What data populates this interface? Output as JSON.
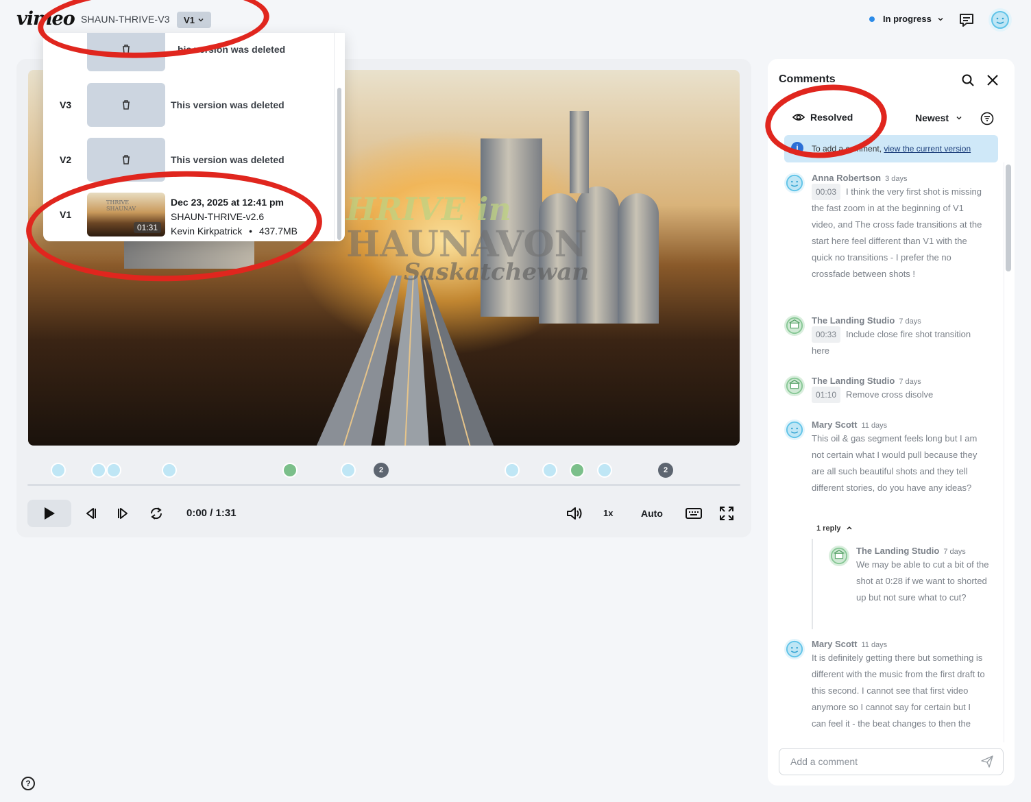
{
  "topbar": {
    "logo": "vimeo",
    "project_name": "SHAUN-THRIVE-V3",
    "version_label": "V1",
    "status_label": "In progress"
  },
  "video": {
    "overlay_line1": "HRIVE in",
    "overlay_line2": "HAUNAVON",
    "overlay_line3": "Saskatchewan"
  },
  "timeline_counts": [
    "2",
    "2"
  ],
  "controls": {
    "time": "0:00 / 1:31",
    "speed": "1x",
    "quality": "Auto"
  },
  "versions": {
    "deleted_text": "This version was deleted",
    "partial_deleted_text": "his version was deleted",
    "rows": [
      {
        "label": "V3"
      },
      {
        "label": "V2"
      }
    ],
    "current": {
      "label": "V1",
      "duration": "01:31",
      "date": "Dec 23, 2025 at 12:41 pm",
      "file": "SHAUN-THRIVE-v2.6",
      "author": "Kevin Kirkpatrick",
      "separator": "•",
      "size": "437.7MB",
      "thumb_text": "THRIVE SHAUNAV"
    }
  },
  "comments_panel": {
    "title": "Comments",
    "resolved_label": "Resolved",
    "sort_label": "Newest",
    "banner_prefix": "To add a comment, ",
    "banner_link": "view the current version",
    "items": [
      {
        "author": "Anna Robertson",
        "ago": "3 days",
        "timestamp": "00:03",
        "text": "I think the very first shot is missing the fast zoom in at the beginning of V1 video, and The cross fade transitions at the start here feel different than V1 with the quick no transitions - I prefer the no crossfade between shots !"
      },
      {
        "author": "The Landing Studio",
        "ago": "7 days",
        "timestamp": "00:33",
        "text": "Include close fire shot transition here"
      },
      {
        "author": "The Landing Studio",
        "ago": "7 days",
        "timestamp": "01:10",
        "text": "Remove cross disolve"
      },
      {
        "author": "Mary Scott",
        "ago": "11 days",
        "timestamp": "",
        "text": "This oil & gas segment feels long but I am not certain what I would pull because they are all such beautiful shots and they tell different stories, do you have any ideas?"
      },
      {
        "author": "Mary Scott",
        "ago": "11 days",
        "timestamp": "",
        "text": "It is definitely getting there but something is different with the music from the first draft to this second.  I cannot see that first video anymore so I cannot say for certain but I can feel it - the beat changes to then the"
      }
    ],
    "reply_toggle": "1 reply",
    "reply": {
      "author": "The Landing Studio",
      "ago": "7 days",
      "text": "We may be able to cut a bit of the shot at 0:28 if we want to shorted up but not sure what to cut?"
    },
    "add_placeholder": "Add a comment"
  },
  "help_label": "?",
  "colors": {
    "annotation_red": "#e0261e",
    "status_dot": "#2c8be8",
    "banner_bg": "#cfe8f8",
    "avatar_user": "#bfe6f5",
    "avatar_studio": "#7bbf8a"
  }
}
